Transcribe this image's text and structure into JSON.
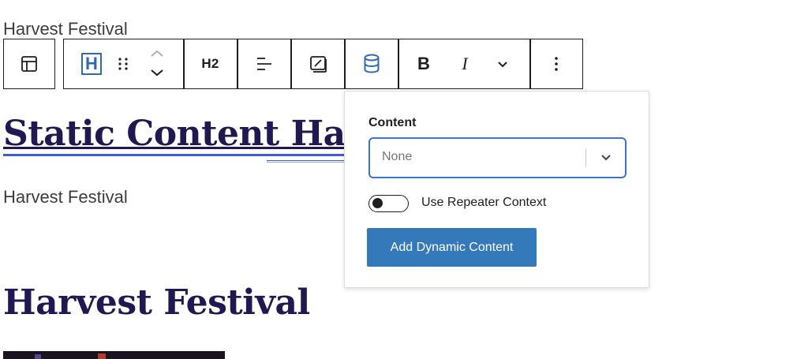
{
  "block_above": {
    "text": "Harvest Festival"
  },
  "toolbar": {
    "heading_level_label": "H2",
    "bold_label": "B",
    "italic_label": "I",
    "heading_block_letter": "H"
  },
  "static_heading": {
    "text": "Static Content Harv"
  },
  "paragraph": {
    "text": "Harvest Festival"
  },
  "main_heading": {
    "text": "Harvest Festival"
  },
  "popover": {
    "content_label": "Content",
    "select_value": "None",
    "toggle_label": "Use Repeater Context",
    "toggle_on": false,
    "add_button_label": "Add Dynamic Content"
  },
  "colors": {
    "heading": "#1f1851",
    "accent_blue": "#2f69b3",
    "button_blue": "#3479b9",
    "focus_blue": "#3c74c8"
  },
  "icons": {
    "block_type": "layout-icon",
    "heading": "heading-block-icon",
    "drag": "drag-handle-icon",
    "move": "move-up-down-icon",
    "align": "align-text-icon",
    "image_size": "resize-icon",
    "dynamic_data": "database-icon",
    "more_format": "chevron-down-icon",
    "options": "more-vertical-icon"
  }
}
